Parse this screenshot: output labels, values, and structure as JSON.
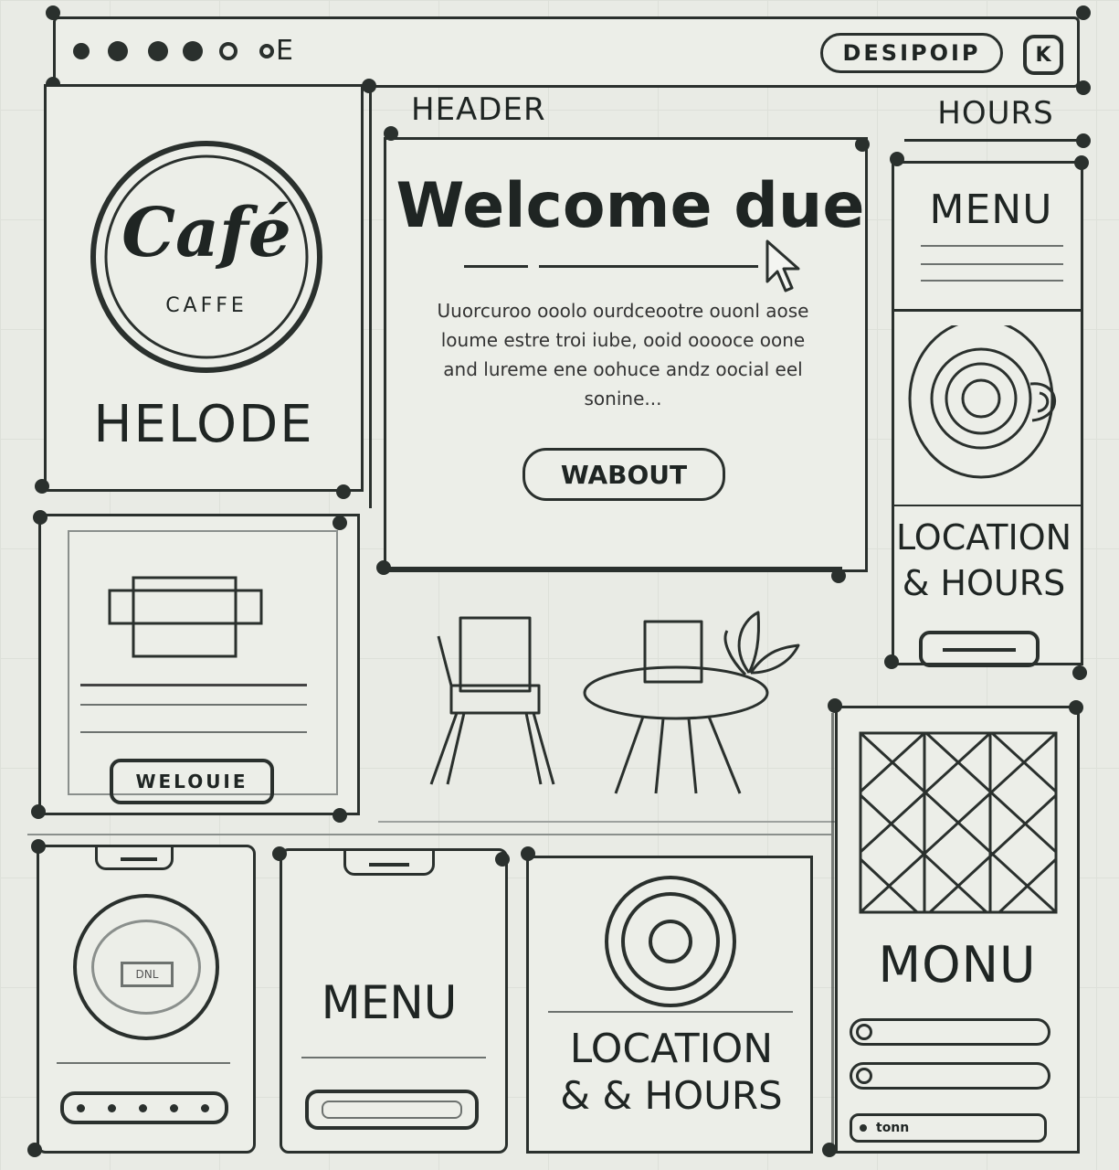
{
  "titlebar": {
    "dots": [
      "dot",
      "dot",
      "dot",
      "dot",
      "circle",
      "circle"
    ],
    "extra_glyph": "E",
    "pill_label": "DESIPOIP",
    "close_glyph": "K"
  },
  "logo": {
    "script": "Café",
    "sub": "CAFFE",
    "caption": "HELODE"
  },
  "header": {
    "label": "HEADER",
    "hours": "HOURS"
  },
  "hero": {
    "title": "Welcome due",
    "body": "Uuorcuroo ooolo ourdceootre ouonl aose loume estre troi iube, ooid ooooce oone and lureme ene oohuce andz oocial eel sonine...",
    "button": "WABOUT"
  },
  "right_panel": {
    "menu": "MENU",
    "location_line1": "LOCATION",
    "location_line2": "& HOURS"
  },
  "welcome_card": {
    "button": "WELOUIE"
  },
  "bottom": {
    "card1_badge": "DNL",
    "card2_label": "MENU",
    "card3_line1": "LOCATION",
    "card3_line2": "& & HOURS",
    "card4_label": "MONU",
    "card4_input": "tonn"
  },
  "colors": {
    "ink": "#2a302d",
    "paper": "#eceee8"
  }
}
